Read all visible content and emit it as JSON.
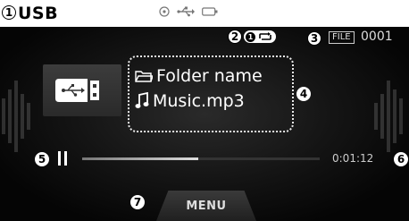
{
  "header": {
    "source_label": "USB",
    "status_icons": [
      "disc-icon",
      "usb-icon",
      "battery-icon"
    ]
  },
  "repeat": {
    "badge_number": "1"
  },
  "file_info": {
    "tag": "FILE",
    "count": "0001"
  },
  "track": {
    "folder_name": "Folder name",
    "file_name": "Music.mp3"
  },
  "playback": {
    "state_icon": "pause-icon",
    "elapsed": "0:01:12",
    "progress_fraction": 0.49
  },
  "menu": {
    "label": "MENU"
  },
  "callouts": [
    "1",
    "2",
    "3",
    "4",
    "5",
    "6",
    "7"
  ],
  "colors": {
    "background": "#000000",
    "foreground": "#ffffff",
    "accent_gray": "#cccccc"
  }
}
